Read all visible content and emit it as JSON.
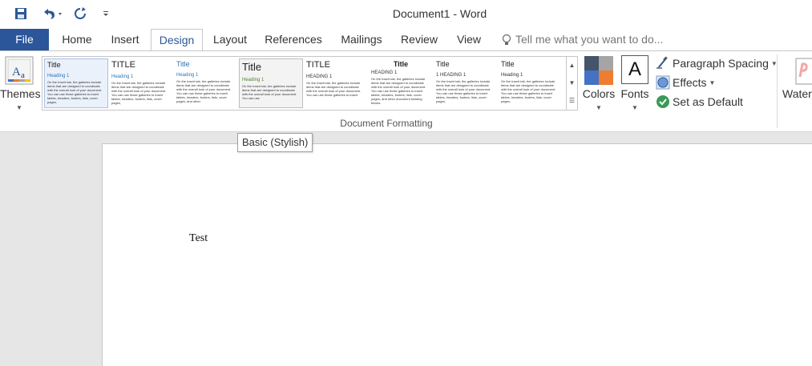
{
  "window": {
    "title": "Document1 - Word"
  },
  "quick_access": {
    "save_icon": "save-icon",
    "undo_icon": "undo-icon",
    "redo_icon": "redo-icon",
    "customize_icon": "customize-qat-icon"
  },
  "tabs": [
    {
      "label": "File"
    },
    {
      "label": "Home"
    },
    {
      "label": "Insert"
    },
    {
      "label": "Design"
    },
    {
      "label": "Layout"
    },
    {
      "label": "References"
    },
    {
      "label": "Mailings"
    },
    {
      "label": "Review"
    },
    {
      "label": "View"
    }
  ],
  "active_tab": "Design",
  "tell_me": {
    "placeholder": "Tell me what you want to do..."
  },
  "ribbon": {
    "themes_label": "Themes",
    "colors_label": "Colors",
    "fonts_label": "Fonts",
    "fonts_glyph": "A",
    "paragraph_spacing_label": "Paragraph Spacing",
    "effects_label": "Effects",
    "set_default_label": "Set as Default",
    "watermark_label": "Waterm",
    "group_label": "Document Formatting",
    "style_set": [
      {
        "title": "Title",
        "heading": "Heading 1",
        "body": "On the Insert tab, the galleries include items that are designed to coordinate with the overall look of your document. You can use these galleries to insert tables, headers, footers, lists, cover pages,"
      },
      {
        "title": "TITLE",
        "heading": "Heading 1",
        "body": "On the Insert tab, the galleries include items that are designed to coordinate with the overall look of your document. You can use these galleries to insert tables, headers, footers, lists, cover pages,"
      },
      {
        "title": "Title",
        "heading": "Heading 1",
        "body": "On the Insert tab, the galleries include items that are designed to coordinate with the overall look of your document. You can use these galleries to insert tables, headers, footers, lists, cover pages, and other"
      },
      {
        "title": "Title",
        "heading": "Heading 1",
        "body": "On the Insert tab, the galleries include items that are designed to coordinate with the overall look of your document. You can use"
      },
      {
        "title": "TITLE",
        "heading": "HEADING 1",
        "body": "On the Insert tab, the galleries include items that are designed to coordinate with the overall look of your document. You can use these galleries to insert"
      },
      {
        "title": "Title",
        "heading": "HEADING 1",
        "body": "On the Insert tab, the galleries include items that are designed to coordinate with the overall look of your document. You can use these galleries to insert tables, headers, footers, lists, cover pages, and other document building blocks."
      },
      {
        "title": "Title",
        "heading": "1   HEADING 1",
        "body": "On the Insert tab, the galleries include items that are designed to coordinate with the overall look of your document. You can use these galleries to insert tables, headers, footers, lists, cover pages,"
      },
      {
        "title": "Title",
        "heading": "Heading 1",
        "body": "On the Insert tab, the galleries include items that are designed to coordinate with the overall look of your document. You can use these galleries to insert tables, headers, footers, lists, cover pages,"
      }
    ],
    "selected_style_index": 0,
    "hovered_style_index": 3
  },
  "tooltip": {
    "text": "Basic (Stylish)"
  },
  "document": {
    "text": "Test"
  },
  "colors": {
    "accent": "#2b579a",
    "heading_blue": "#2e74b5",
    "palette": [
      "#44546a",
      "#a5a5a5",
      "#4472c4",
      "#ed7d31"
    ]
  }
}
